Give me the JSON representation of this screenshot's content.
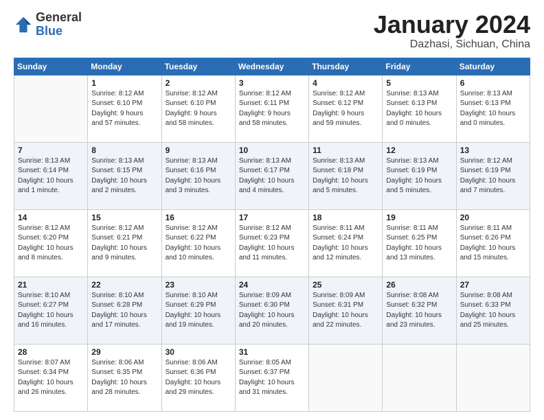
{
  "header": {
    "logo_general": "General",
    "logo_blue": "Blue",
    "title": "January 2024",
    "subtitle": "Dazhasi, Sichuan, China"
  },
  "weekdays": [
    "Sunday",
    "Monday",
    "Tuesday",
    "Wednesday",
    "Thursday",
    "Friday",
    "Saturday"
  ],
  "weeks": [
    [
      {
        "day": "",
        "info": ""
      },
      {
        "day": "1",
        "info": "Sunrise: 8:12 AM\nSunset: 6:10 PM\nDaylight: 9 hours\nand 57 minutes."
      },
      {
        "day": "2",
        "info": "Sunrise: 8:12 AM\nSunset: 6:10 PM\nDaylight: 9 hours\nand 58 minutes."
      },
      {
        "day": "3",
        "info": "Sunrise: 8:12 AM\nSunset: 6:11 PM\nDaylight: 9 hours\nand 58 minutes."
      },
      {
        "day": "4",
        "info": "Sunrise: 8:12 AM\nSunset: 6:12 PM\nDaylight: 9 hours\nand 59 minutes."
      },
      {
        "day": "5",
        "info": "Sunrise: 8:13 AM\nSunset: 6:13 PM\nDaylight: 10 hours\nand 0 minutes."
      },
      {
        "day": "6",
        "info": "Sunrise: 8:13 AM\nSunset: 6:13 PM\nDaylight: 10 hours\nand 0 minutes."
      }
    ],
    [
      {
        "day": "7",
        "info": "Sunrise: 8:13 AM\nSunset: 6:14 PM\nDaylight: 10 hours\nand 1 minute."
      },
      {
        "day": "8",
        "info": "Sunrise: 8:13 AM\nSunset: 6:15 PM\nDaylight: 10 hours\nand 2 minutes."
      },
      {
        "day": "9",
        "info": "Sunrise: 8:13 AM\nSunset: 6:16 PM\nDaylight: 10 hours\nand 3 minutes."
      },
      {
        "day": "10",
        "info": "Sunrise: 8:13 AM\nSunset: 6:17 PM\nDaylight: 10 hours\nand 4 minutes."
      },
      {
        "day": "11",
        "info": "Sunrise: 8:13 AM\nSunset: 6:18 PM\nDaylight: 10 hours\nand 5 minutes."
      },
      {
        "day": "12",
        "info": "Sunrise: 8:13 AM\nSunset: 6:19 PM\nDaylight: 10 hours\nand 5 minutes."
      },
      {
        "day": "13",
        "info": "Sunrise: 8:12 AM\nSunset: 6:19 PM\nDaylight: 10 hours\nand 7 minutes."
      }
    ],
    [
      {
        "day": "14",
        "info": "Sunrise: 8:12 AM\nSunset: 6:20 PM\nDaylight: 10 hours\nand 8 minutes."
      },
      {
        "day": "15",
        "info": "Sunrise: 8:12 AM\nSunset: 6:21 PM\nDaylight: 10 hours\nand 9 minutes."
      },
      {
        "day": "16",
        "info": "Sunrise: 8:12 AM\nSunset: 6:22 PM\nDaylight: 10 hours\nand 10 minutes."
      },
      {
        "day": "17",
        "info": "Sunrise: 8:12 AM\nSunset: 6:23 PM\nDaylight: 10 hours\nand 11 minutes."
      },
      {
        "day": "18",
        "info": "Sunrise: 8:11 AM\nSunset: 6:24 PM\nDaylight: 10 hours\nand 12 minutes."
      },
      {
        "day": "19",
        "info": "Sunrise: 8:11 AM\nSunset: 6:25 PM\nDaylight: 10 hours\nand 13 minutes."
      },
      {
        "day": "20",
        "info": "Sunrise: 8:11 AM\nSunset: 6:26 PM\nDaylight: 10 hours\nand 15 minutes."
      }
    ],
    [
      {
        "day": "21",
        "info": "Sunrise: 8:10 AM\nSunset: 6:27 PM\nDaylight: 10 hours\nand 16 minutes."
      },
      {
        "day": "22",
        "info": "Sunrise: 8:10 AM\nSunset: 6:28 PM\nDaylight: 10 hours\nand 17 minutes."
      },
      {
        "day": "23",
        "info": "Sunrise: 8:10 AM\nSunset: 6:29 PM\nDaylight: 10 hours\nand 19 minutes."
      },
      {
        "day": "24",
        "info": "Sunrise: 8:09 AM\nSunset: 6:30 PM\nDaylight: 10 hours\nand 20 minutes."
      },
      {
        "day": "25",
        "info": "Sunrise: 8:09 AM\nSunset: 6:31 PM\nDaylight: 10 hours\nand 22 minutes."
      },
      {
        "day": "26",
        "info": "Sunrise: 8:08 AM\nSunset: 6:32 PM\nDaylight: 10 hours\nand 23 minutes."
      },
      {
        "day": "27",
        "info": "Sunrise: 8:08 AM\nSunset: 6:33 PM\nDaylight: 10 hours\nand 25 minutes."
      }
    ],
    [
      {
        "day": "28",
        "info": "Sunrise: 8:07 AM\nSunset: 6:34 PM\nDaylight: 10 hours\nand 26 minutes."
      },
      {
        "day": "29",
        "info": "Sunrise: 8:06 AM\nSunset: 6:35 PM\nDaylight: 10 hours\nand 28 minutes."
      },
      {
        "day": "30",
        "info": "Sunrise: 8:06 AM\nSunset: 6:36 PM\nDaylight: 10 hours\nand 29 minutes."
      },
      {
        "day": "31",
        "info": "Sunrise: 8:05 AM\nSunset: 6:37 PM\nDaylight: 10 hours\nand 31 minutes."
      },
      {
        "day": "",
        "info": ""
      },
      {
        "day": "",
        "info": ""
      },
      {
        "day": "",
        "info": ""
      }
    ]
  ]
}
